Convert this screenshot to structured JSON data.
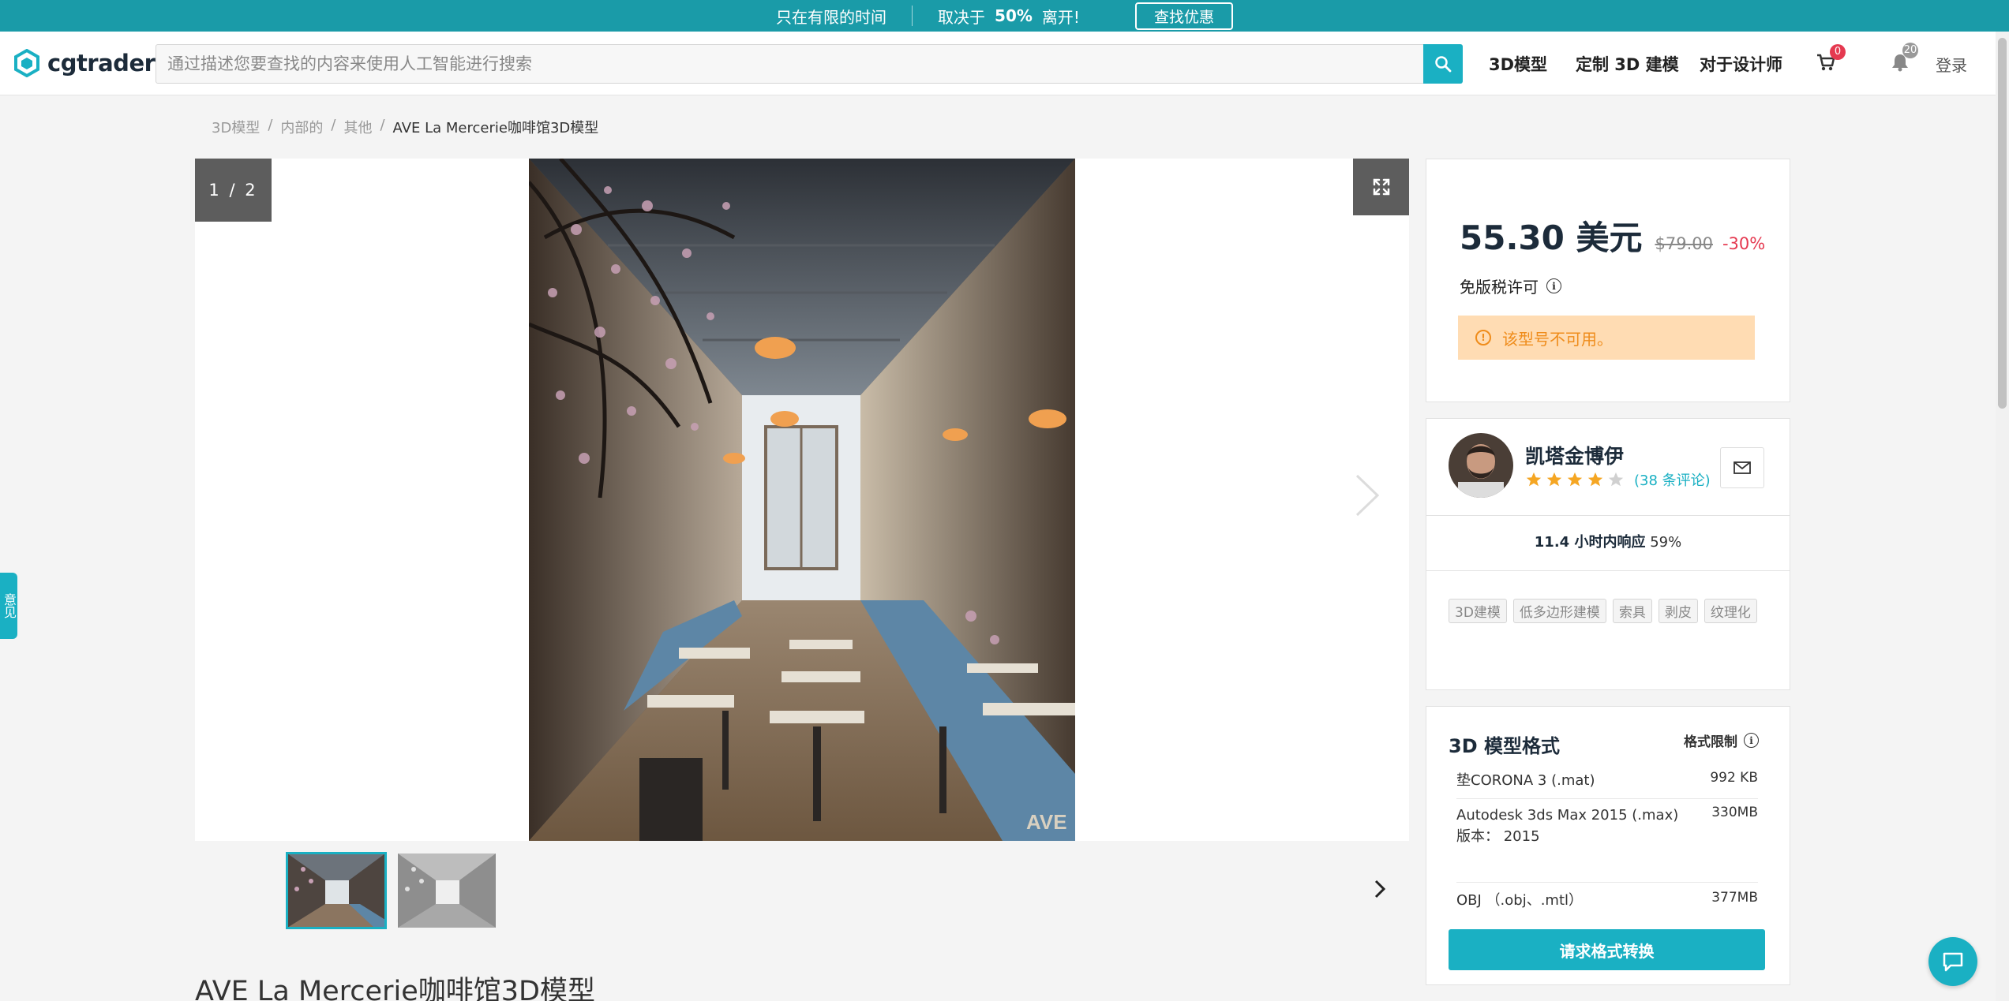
{
  "promo": {
    "text": "只在有限的时间",
    "discount_prefix": "取决于",
    "discount": "50%",
    "discount_suffix": "离开!",
    "button": "查找优惠"
  },
  "header": {
    "logo": "cgtrader",
    "search_placeholder": "通过描述您要查找的内容来使用人工智能进行搜索",
    "nav": [
      "3D模型",
      "定制 3D 建模",
      "对于设计师"
    ],
    "cart_count": "0",
    "notif_count": "20",
    "login": "登录"
  },
  "breadcrumb": [
    "3D模型",
    "内部的",
    "其他",
    "AVE La Mercerie咖啡馆3D模型"
  ],
  "gallery": {
    "counter": "1 / 2"
  },
  "product": {
    "title": "AVE La Mercerie咖啡馆3D模型"
  },
  "pricing": {
    "price": "55.30 美元",
    "old_price": "$79.00",
    "discount": "-30%",
    "license": "免版税许可",
    "alert": "该型号不可用。"
  },
  "seller": {
    "name": "凯塔金博伊",
    "rating": 4,
    "reviews": "(38 条评论)",
    "response_bold": "11.4 小时内响应",
    "response_rate": "59%",
    "tags": [
      "3D建模",
      "低多边形建模",
      "索具",
      "剥皮",
      "纹理化"
    ]
  },
  "formats": {
    "title": "3D 模型格式",
    "limit_label": "格式限制",
    "rows": [
      {
        "name": "垫CORONA 3 (.mat)",
        "size": "992 KB"
      },
      {
        "name": "Autodesk 3ds Max 2015 (.max)",
        "version": "版本：  2015",
        "size": "330MB"
      },
      {
        "name": "OBJ  （.obj、.mtl）",
        "size": "377MB"
      }
    ],
    "convert_button": "请求格式转换"
  },
  "side_tab": "意见",
  "colors": {
    "accent": "#1ab0c3",
    "promo_bg": "#1a9ba8",
    "discount_red": "#e53950",
    "alert_bg": "#ffdcb3",
    "alert_text": "#ef8c1b"
  }
}
